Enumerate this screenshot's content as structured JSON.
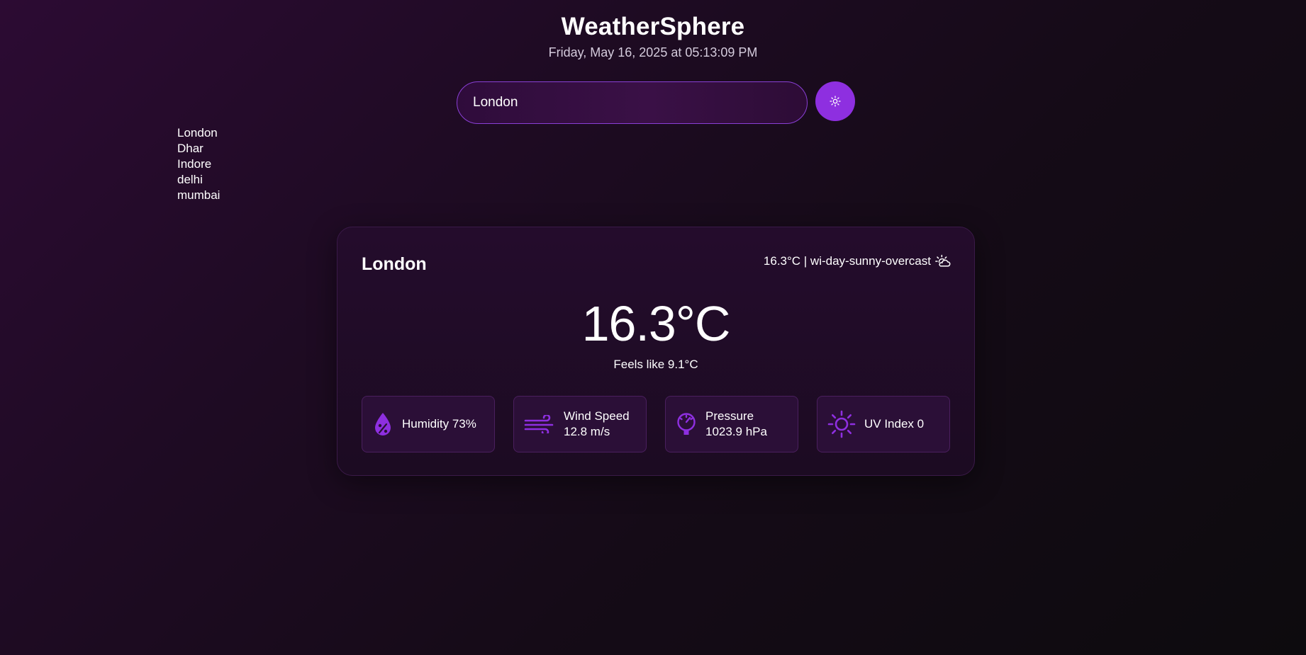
{
  "app": {
    "title": "WeatherSphere",
    "datetime": "Friday, May 16, 2025 at 05:13:09 PM"
  },
  "search": {
    "value": "London",
    "button_icon": "sun-icon"
  },
  "history": [
    "London",
    "Dhar",
    "Indore",
    "delhi",
    "mumbai"
  ],
  "weather": {
    "city": "London",
    "condition": "16.3°C | wi-day-sunny-overcast",
    "condition_icon": "sun-cloud-icon",
    "temperature": "16.3°C",
    "feels_like": "Feels like 9.1°C",
    "stats": {
      "humidity": {
        "label": "Humidity 73%",
        "icon": "humidity-drop-icon"
      },
      "wind": {
        "label": "Wind Speed",
        "value": "12.8 m/s",
        "icon": "wind-icon"
      },
      "pressure": {
        "label": "Pressure",
        "value": "1023.9 hPa",
        "icon": "gauge-icon"
      },
      "uv": {
        "label": "UV Index 0",
        "icon": "sun-icon"
      }
    }
  },
  "colors": {
    "accent": "#8e2fe0",
    "card_bg": "#240c2c",
    "stat_bg": "#2b0f37"
  }
}
